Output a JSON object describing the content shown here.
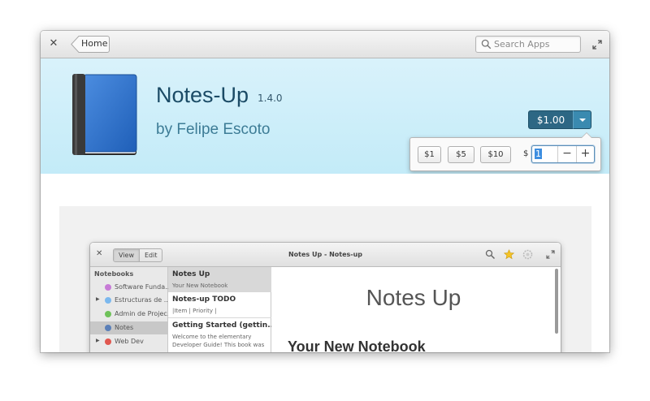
{
  "headerbar": {
    "back_label": "Home",
    "search_placeholder": "Search Apps"
  },
  "app": {
    "name": "Notes-Up",
    "version": "1.4.0",
    "author": "by Felipe Escoto",
    "icon": "book-icon"
  },
  "purchase": {
    "price_label": "$1.00",
    "amount_options": [
      "$1",
      "$5",
      "$10"
    ],
    "custom_prefix": "$",
    "custom_value": "1",
    "minus_label": "−",
    "plus_label": "+"
  },
  "screenshot": {
    "window_title": "Notes Up - Notes-up",
    "view_tabs": [
      "View",
      "Edit"
    ],
    "sidebar_heading": "Notebooks",
    "notebooks": [
      {
        "label": "Software Funda...",
        "color": "#c77bd6",
        "expander": false
      },
      {
        "label": "Estructuras de ...",
        "color": "#7bb8ee",
        "expander": true
      },
      {
        "label": "Admin de Projec...",
        "color": "#6fc25a",
        "expander": false
      },
      {
        "label": "Notes",
        "color": "#5a7fb8",
        "expander": false,
        "selected": true
      },
      {
        "label": "Web Dev",
        "color": "#e0574f",
        "expander": true
      }
    ],
    "pages": [
      {
        "title": "Notes Up",
        "subtitle": "Your New Notebook"
      },
      {
        "title": "Notes-up TODO",
        "subtitle": "|Item | Priority |"
      },
      {
        "title": "Getting Started (gettin...",
        "subtitle": "Welcome to the elementary Developer Guide! This book was"
      }
    ],
    "doc_title": "Notes Up",
    "doc_heading": "Your New Notebook"
  },
  "colors": {
    "banner_top": "#d9f2fb",
    "banner_bottom": "#c3ebf8",
    "title": "#1b4b66",
    "author": "#3d7c96",
    "price_button": "#2d6784"
  }
}
